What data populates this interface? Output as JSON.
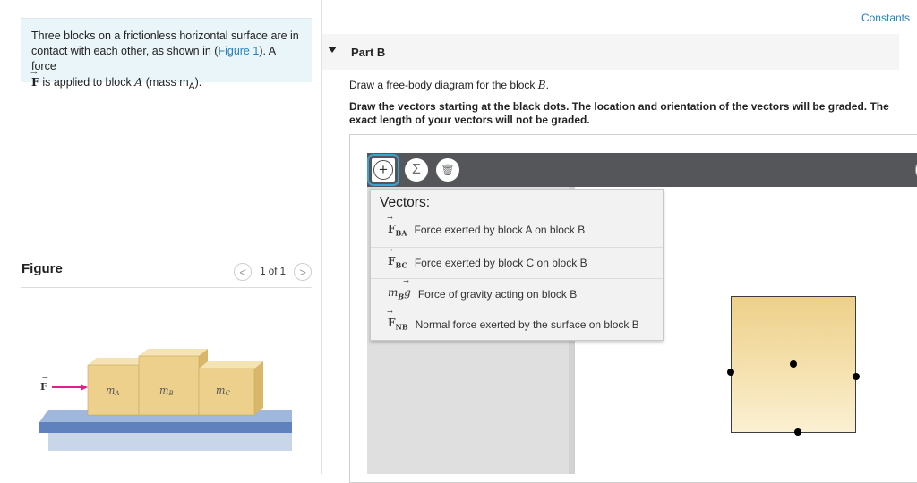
{
  "intro": {
    "line1": "Three blocks on a frictionless horizontal surface are in",
    "line2_prefix": "contact with each other, as shown in (",
    "figure_link": "Figure 1",
    "line2_suffix": "). A force",
    "force_symbol": "F",
    "line3_text": " is applied to block ",
    "block_letter": "A",
    "mass_text": " (mass m",
    "mass_sub": "A",
    "mass_end": ")."
  },
  "figure": {
    "title": "Figure",
    "pager_text": "1 of 1",
    "prev_icon": "<",
    "next_icon": ">",
    "force_label": "F",
    "block_labels": [
      "m",
      "m",
      "m"
    ],
    "block_subs": [
      "A",
      "B",
      "C"
    ]
  },
  "header": {
    "constants_link": "Constants"
  },
  "part": {
    "label": "Part B"
  },
  "question": {
    "prompt_prefix": "Draw a free-body diagram for the block ",
    "prompt_var": "B",
    "prompt_suffix": ".",
    "instructions": "Draw the vectors starting at the black dots. The location and orientation of the vectors will be graded. The exact length of your vectors will not be graded."
  },
  "toolbar": {
    "add_icon": "+",
    "sum_icon": "Σ",
    "trash_icon": "🗑"
  },
  "vectors_menu": {
    "title": "Vectors:",
    "items": [
      {
        "symbol": "F",
        "sub": "BA",
        "label": "Force exerted by block A on block B"
      },
      {
        "symbol": "F",
        "sub": "BC",
        "label": "Force exerted by block C on block B"
      },
      {
        "symbol": "m",
        "sub": "B",
        "symbol_tail": "g",
        "label": "Force of gravity acting on block B"
      },
      {
        "symbol": "F",
        "sub": "NB",
        "label": "Normal force exerted by the surface on block B"
      }
    ]
  },
  "colors": {
    "link": "#2a7fb8",
    "toolbar": "#54565a",
    "intro_bg": "#e9f5f8",
    "block_top": "#edd08a",
    "force_arrow": "#e0208a",
    "table_top": "#6b8fc7"
  }
}
